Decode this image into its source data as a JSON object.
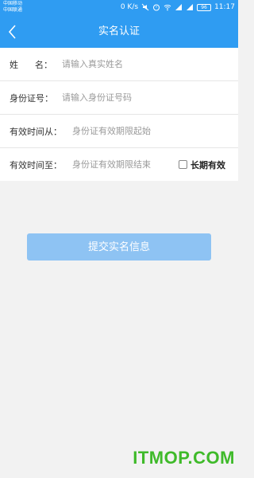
{
  "status_bar": {
    "carrier_1": "中国移动",
    "carrier_2": "中国联通",
    "speed": "0 K/s",
    "battery": "96",
    "time": "11:17"
  },
  "header": {
    "title": "实名认证",
    "back_icon": "chevron-left-icon"
  },
  "form": {
    "name": {
      "label_char_1": "姓",
      "label_char_2": "名：",
      "placeholder": "请输入真实姓名",
      "value": ""
    },
    "id_number": {
      "label": "身份证号：",
      "placeholder": "请输入身份证号码",
      "value": ""
    },
    "valid_from": {
      "label": "有效时间从：",
      "placeholder": "身份证有效期限起始",
      "value": ""
    },
    "valid_to": {
      "label": "有效时间至：",
      "placeholder": "身份证有效期限结束",
      "value": "",
      "long_term_label": "长期有效",
      "long_term_checked": false
    }
  },
  "submit": {
    "label": "提交实名信息"
  },
  "watermark": {
    "text": "ITMOP.COM"
  },
  "colors": {
    "primary": "#2f9cf2",
    "button_disabled": "#8ec3f3",
    "watermark": "#3fba2a",
    "background": "#f2f2f2"
  }
}
